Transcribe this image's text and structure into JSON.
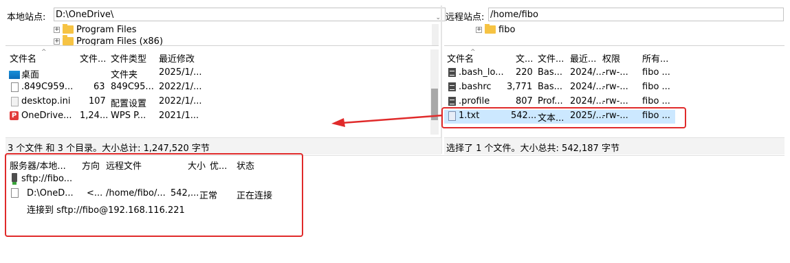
{
  "local_site": {
    "label": "本地站点:",
    "path": "D:\\OneDrive\\",
    "tree": [
      {
        "label": "Program Files",
        "expander": "+"
      },
      {
        "label": "Program Files (x86)",
        "expander": "+"
      }
    ]
  },
  "remote_site": {
    "label": "远程站点:",
    "path": "/home/fibo",
    "tree": [
      {
        "label": "fibo",
        "expander": "+"
      }
    ]
  },
  "local_files": {
    "headers": [
      "文件名",
      "文件...",
      "文件类型",
      "最近修改"
    ],
    "rows": [
      {
        "icon": "desktop-folder-icon",
        "name": "桌面",
        "size": "",
        "type": "文件夹",
        "modified": "2025/1/..."
      },
      {
        "icon": "file-icon",
        "name": ".849C959...",
        "size": "63",
        "type": "849C95...",
        "modified": "2022/1/..."
      },
      {
        "icon": "ini-file-icon",
        "name": "desktop.ini",
        "size": "107",
        "type": "配置设置",
        "modified": "2022/1/..."
      },
      {
        "icon": "wps-icon",
        "name": "OneDrive...",
        "size": "1,24...",
        "type": "WPS P...",
        "modified": "2021/1..."
      }
    ],
    "status": "3 个文件 和 3 个目录。大小总计: 1,247,520 字节"
  },
  "remote_files": {
    "headers": [
      "文件名",
      "文...",
      "文件...",
      "最近...",
      "权限",
      "所有..."
    ],
    "rows": [
      {
        "icon": "file-icon",
        "name": ".bash_lo...",
        "size": "220",
        "type": "Bas...",
        "modified": "2024/...",
        "perm": "-rw-...",
        "owner": "fibo ...",
        "selected": false
      },
      {
        "icon": "file-icon",
        "name": ".bashrc",
        "size": "3,771",
        "type": "Bas...",
        "modified": "2024/...",
        "perm": "-rw-...",
        "owner": "fibo ...",
        "selected": false
      },
      {
        "icon": "file-icon",
        "name": ".profile",
        "size": "807",
        "type": "Prof...",
        "modified": "2024/...",
        "perm": "-rw-...",
        "owner": "fibo ...",
        "selected": false
      },
      {
        "icon": "txt-file-icon",
        "name": "1.txt",
        "size": "542...",
        "type": "文本...",
        "modified": "2025/...",
        "perm": "-rw-...",
        "owner": "fibo ...",
        "selected": true
      }
    ],
    "status": "选择了 1 个文件。大小总共: 542,187 字节"
  },
  "queue": {
    "headers": [
      "服务器/本地...",
      "方向",
      "远程文件",
      "大小",
      "优...",
      "状态"
    ],
    "server": "sftp://fibo...",
    "transfer": {
      "local": "D:\\OneD...",
      "direction": "<...",
      "remote": "/home/fibo/...",
      "size": "542,...",
      "priority": "正常",
      "status": "正在连接"
    },
    "message": "连接到 sftp://fibo@192.168.116.221"
  },
  "colors": {
    "annotation": "#e02a2a",
    "selection": "#cce8ff"
  }
}
